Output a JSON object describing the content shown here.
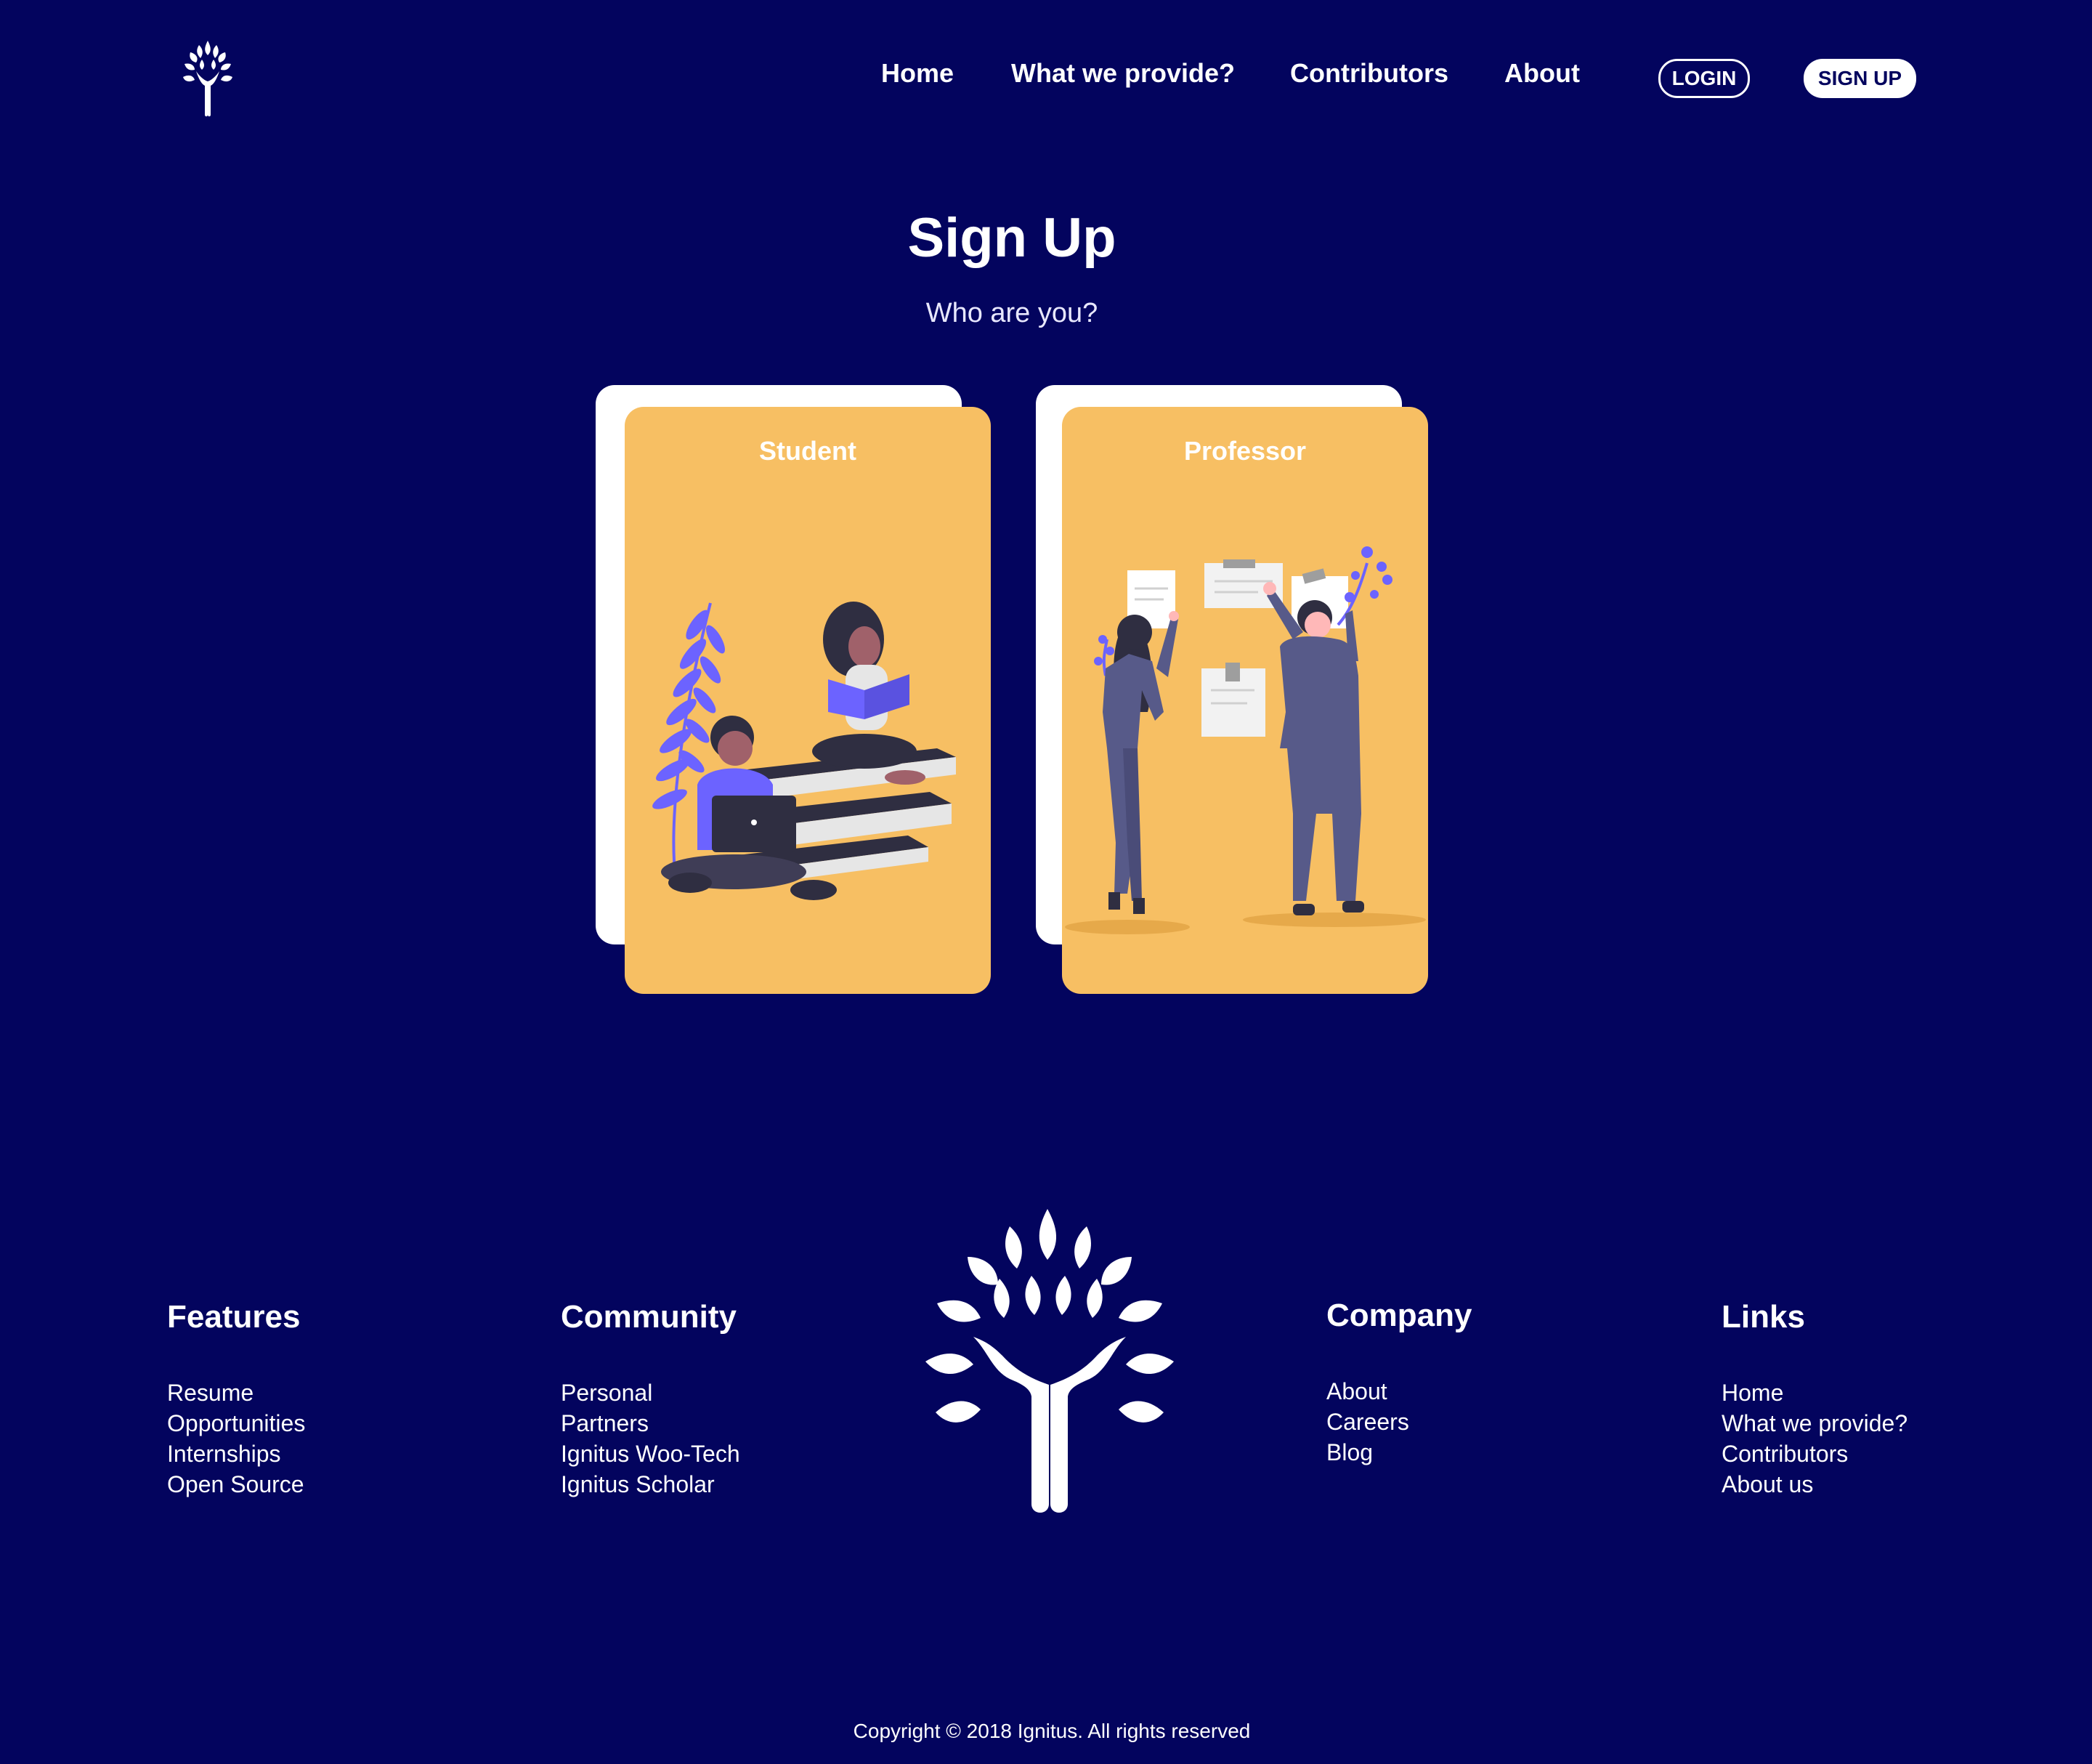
{
  "nav": {
    "logo_icon": "tree-flame-logo-icon",
    "links": [
      "Home",
      "What we provide?",
      "Contributors",
      "About"
    ],
    "login_label": "LOGIN",
    "signup_label": "SIGN UP"
  },
  "header": {
    "title": "Sign Up",
    "subtitle": "Who are you?"
  },
  "cards": [
    {
      "label": "Student",
      "illustration": "students-reading-books-illustration"
    },
    {
      "label": "Professor",
      "illustration": "professors-at-board-illustration"
    }
  ],
  "footer": {
    "columns": [
      {
        "heading": "Features",
        "links": [
          "Resume",
          "Opportunities",
          "Internships",
          "Open Source"
        ]
      },
      {
        "heading": "Community",
        "links": [
          "Personal",
          "Partners",
          "Ignitus Woo-Tech",
          "Ignitus Scholar"
        ]
      },
      {
        "heading": "Company",
        "links": [
          "About",
          "Careers",
          "Blog"
        ]
      },
      {
        "heading": "Links",
        "links": [
          "Home",
          "What we provide?",
          "Contributors",
          "About us"
        ]
      }
    ],
    "copyright": "Copyright © 2018 Ignitus. All rights reserved"
  },
  "colors": {
    "background": "#03045e",
    "card": "#f7bf63",
    "accent_purple": "#6c63ff",
    "text": "#ffffff"
  }
}
